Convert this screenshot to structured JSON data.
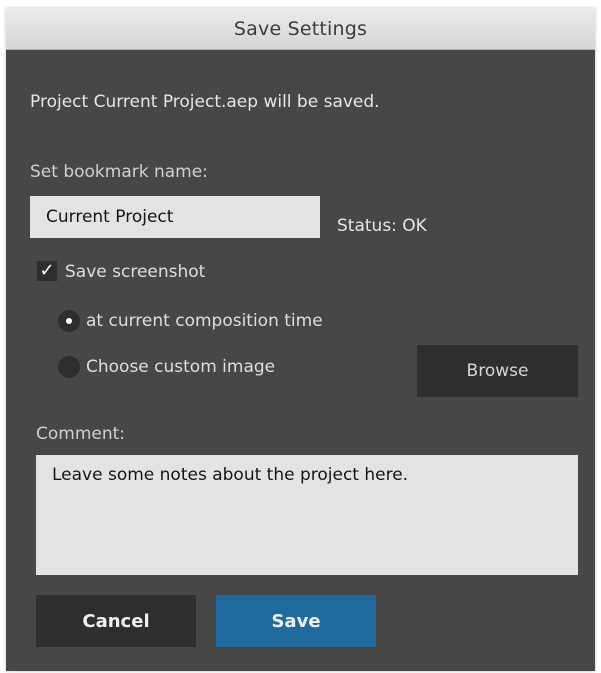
{
  "dialog": {
    "title": "Save Settings",
    "message": "Project Current Project.aep will be saved."
  },
  "bookmark": {
    "label": "Set bookmark name:",
    "value": "Current Project",
    "status": "Status: OK"
  },
  "screenshot": {
    "checkbox_label": "Save screenshot",
    "checked": true,
    "check_glyph": "✓",
    "options": [
      {
        "label": "at current composition time",
        "selected": true
      },
      {
        "label": "Choose custom image",
        "selected": false
      }
    ],
    "browse_label": "Browse"
  },
  "comment": {
    "label": "Comment:",
    "value": "Leave some notes about the project here."
  },
  "buttons": {
    "cancel": "Cancel",
    "save": "Save"
  },
  "colors": {
    "panel_bg": "#474747",
    "input_bg": "#e3e3e3",
    "control_bg": "#2e2e2e",
    "primary": "#1f6b9e"
  }
}
